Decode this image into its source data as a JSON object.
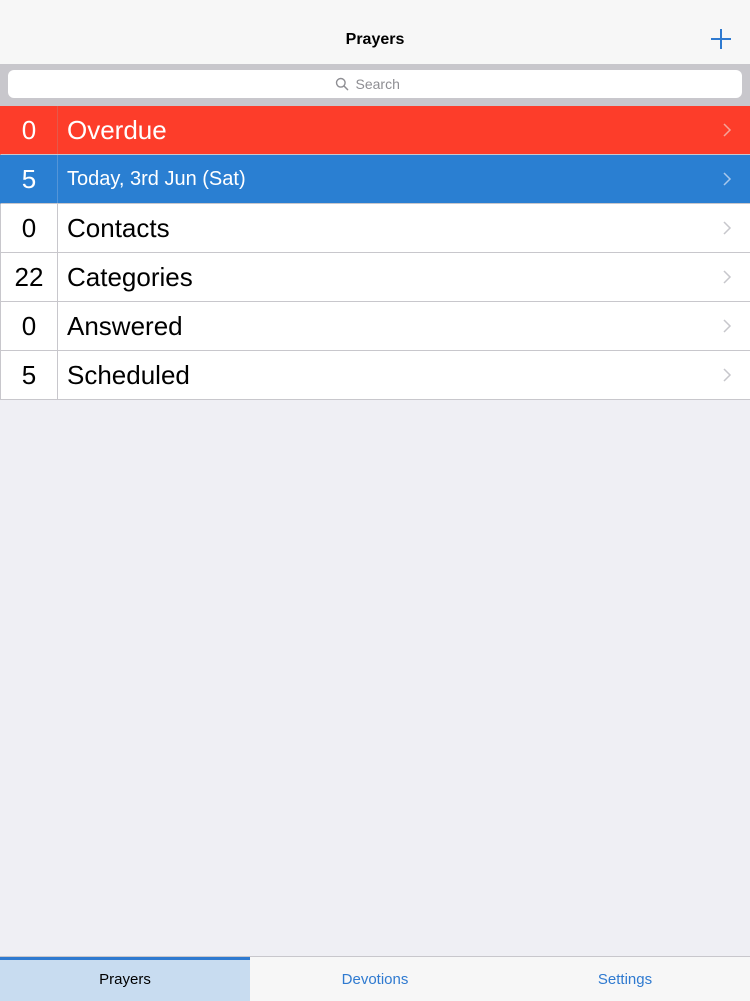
{
  "navbar": {
    "title": "Prayers",
    "add_icon": "plus-icon"
  },
  "search": {
    "placeholder": "Search"
  },
  "colors": {
    "accent": "#2f7ad0",
    "overdue": "#fd3d2a",
    "today": "#2a7fd2"
  },
  "rows": [
    {
      "count": "0",
      "label": "Overdue"
    },
    {
      "count": "5",
      "label": "Today, 3rd Jun (Sat)"
    },
    {
      "count": "0",
      "label": "Contacts"
    },
    {
      "count": "22",
      "label": "Categories"
    },
    {
      "count": "0",
      "label": "Answered"
    },
    {
      "count": "5",
      "label": "Scheduled"
    }
  ],
  "tabs": [
    {
      "label": "Prayers",
      "active": true
    },
    {
      "label": "Devotions",
      "active": false
    },
    {
      "label": "Settings",
      "active": false
    }
  ]
}
